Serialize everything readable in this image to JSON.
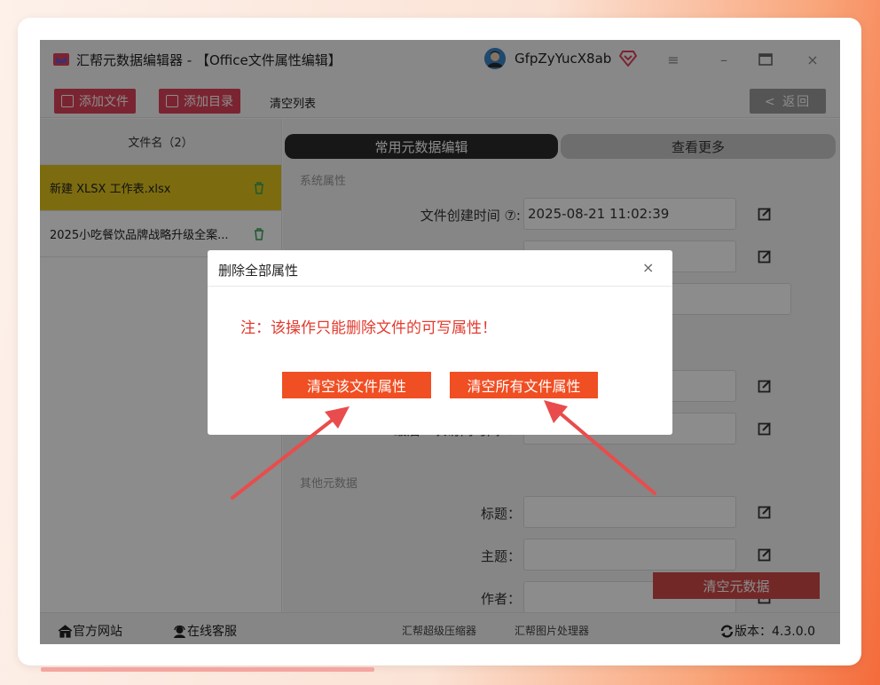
{
  "window": {
    "title": "汇帮元数据编辑器 - 【Office文件属性编辑】",
    "username": "GfpZyYucX8ab"
  },
  "toolbar": {
    "add_file": "添加文件",
    "add_dir": "添加目录",
    "clear_list": "清空列表",
    "back": "< 返回"
  },
  "file_list": {
    "header": "文件名（2）",
    "files": [
      {
        "name": "新建 XLSX 工作表.xlsx"
      },
      {
        "name": "2025小吃餐饮品牌战略升级全案..."
      }
    ]
  },
  "tabs": {
    "common": "常用元数据编辑",
    "more": "查看更多"
  },
  "system_props": {
    "section": "系统属性",
    "created_label": "文件创建时间 ⑦:",
    "created_value": "2025-08-21 11:02:39"
  },
  "other_meta": {
    "section": "其他元数据",
    "title_label": "标题：",
    "subject_label": "主题：",
    "author_label": "作者："
  },
  "partial_label": "最后一次访问时间 ⑦:",
  "clear_metadata": "清空元数据",
  "footer": {
    "official_site": "官方网站",
    "online_service": "在线客服",
    "compress_tool": "汇帮超级压缩器",
    "image_tool": "汇帮图片处理器",
    "version": "版本：4.3.0.0"
  },
  "dialog": {
    "title": "删除全部属性",
    "note": "注：该操作只能删除文件的可写属性！",
    "clear_this": "清空该文件属性",
    "clear_all": "清空所有文件属性"
  },
  "colors": {
    "accent_red": "#e0435a",
    "selected_row": "#e2c51d",
    "dialog_button": "#f04e23",
    "arrow": "#e94c4c"
  }
}
